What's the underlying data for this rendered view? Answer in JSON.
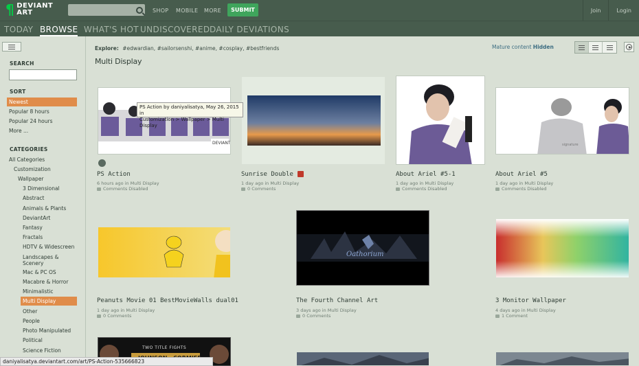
{
  "header": {
    "logo_line1": "DEVIANT",
    "logo_line2": "ART",
    "logo_mark": "¶",
    "search_icon": "search-icon",
    "nav": [
      "SHOP",
      "MOBILE",
      "MORE"
    ],
    "submit_label": "SUBMIT",
    "join_label": "Join",
    "login_label": "Login"
  },
  "tabs": [
    "TODAY",
    "BROWSE",
    "WHAT'S HOT",
    "UNDISCOVERED",
    "DAILY DEVIATIONS"
  ],
  "sidebar": {
    "search_heading": "SEARCH",
    "search_placeholder": "",
    "sort_heading": "SORT",
    "sort_items": [
      "Newest",
      "Popular 8 hours",
      "Popular 24 hours",
      "More ..."
    ],
    "categories_heading": "CATEGORIES",
    "categories": [
      "All Categories",
      "Customization",
      "Wallpaper",
      "3 Dimensional",
      "Abstract",
      "Animals & Plants",
      "DeviantArt",
      "Fantasy",
      "Fractals",
      "HDTV & Widescreen",
      "Landscapes &",
      "Scenery",
      "Mac & PC OS",
      "Macabre & Horror",
      "Minimalistic",
      "Multi Display",
      "Other",
      "People",
      "Photo Manipulated",
      "Political",
      "Science Fiction"
    ]
  },
  "main": {
    "explore_label": "Explore:",
    "explore_tags": [
      "#edwardian",
      "#sailorsenshi",
      "#anime",
      "#cosplay",
      "#bestfriends"
    ],
    "mature_label": "Mature content",
    "mature_value": "Hidden",
    "page_title": "Multi Display"
  },
  "cards": [
    {
      "title": "PS Action",
      "meta": "6 hours ago in Multi Display",
      "comments": "Comments Disabled"
    },
    {
      "title": "Sunrise Double",
      "meta": "1 day ago in Multi Display",
      "comments": "0 Comments"
    },
    {
      "title": "About Ariel #5-1",
      "meta": "1 day ago in Multi Display",
      "comments": "Comments Disabled"
    },
    {
      "title": "About Ariel #5",
      "meta": "1 day ago in Multi Display",
      "comments": "Comments Disabled"
    },
    {
      "title": "Peanuts Movie 01 BestMovieWalls dual01",
      "meta": "1 day ago in Multi Display",
      "comments": "0 Comments"
    },
    {
      "title": "The Fourth Channel Art",
      "meta": "3 days ago in Multi Display",
      "comments": "0 Comments"
    },
    {
      "title": "3 Monitor Wallpaper",
      "meta": "4 days ago in Multi Display",
      "comments": "1 Comment"
    }
  ],
  "thumb_text": {
    "oathorium": "Oathorium",
    "fights": "TWO TITLE FIGHTS",
    "fighters": "JOHNSON · CORMIER"
  },
  "tooltip": {
    "line1": "PS Action by daniyalisatya, May 26, 2015 in",
    "line2": "Customization > Wallpaper > Multi Display"
  },
  "statusbar": "daniyalisatya.deviantart.com/art/PS-Action-535666823",
  "colors": {
    "header": "#475c4d",
    "submit": "#3fa55c",
    "selected": "#e08c4a",
    "background": "#d9e0d5"
  }
}
